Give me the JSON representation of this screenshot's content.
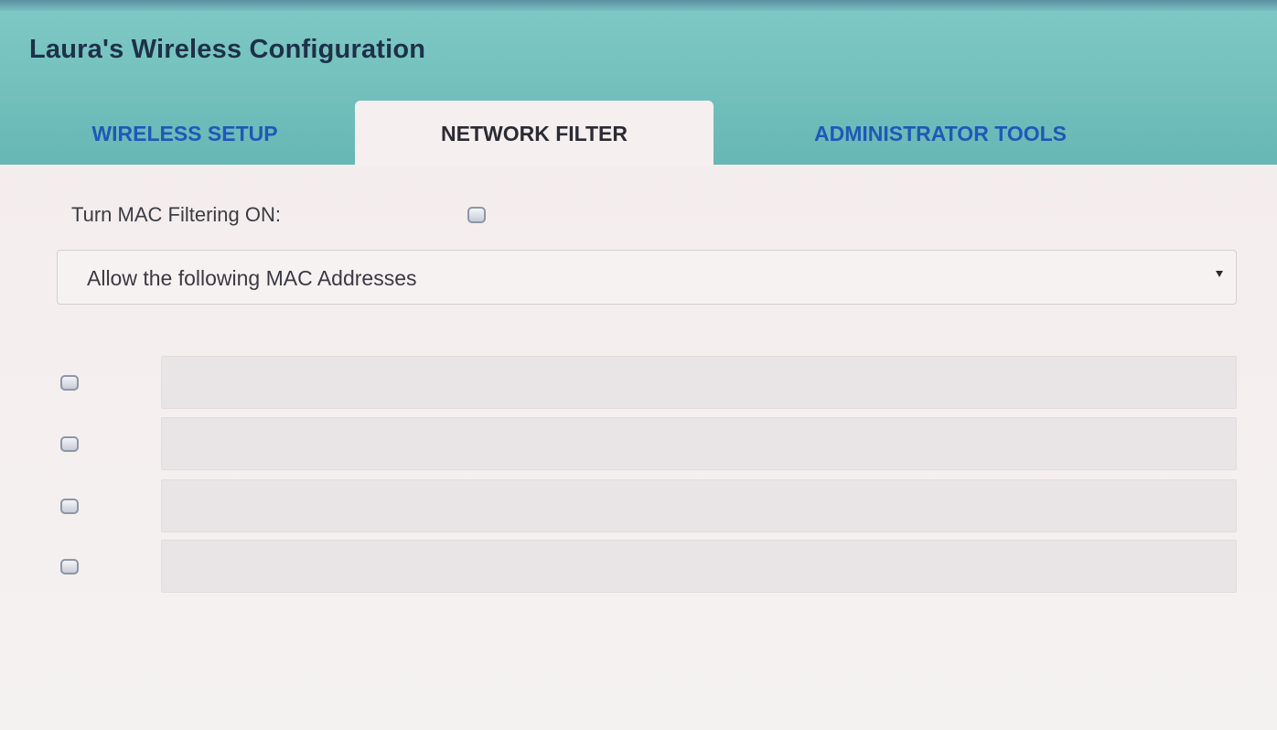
{
  "app": {
    "title": "Laura's Wireless Configuration"
  },
  "tabs": [
    {
      "label": "WIRELESS SETUP",
      "active": false
    },
    {
      "label": "NETWORK FILTER",
      "active": true
    },
    {
      "label": "ADMINISTRATOR TOOLS",
      "active": false
    }
  ],
  "network_filter": {
    "mac_filter_label": "Turn MAC Filtering ON:",
    "mac_filter_checked": false,
    "mode_select": {
      "selected": "Allow the following MAC Addresses"
    },
    "mac_entries": [
      {
        "checked": false,
        "value": ""
      },
      {
        "checked": false,
        "value": ""
      },
      {
        "checked": false,
        "value": ""
      },
      {
        "checked": false,
        "value": ""
      }
    ]
  },
  "colors": {
    "header": "#73c0bd",
    "title_text": "#1d3148",
    "inactive_tab_text": "#1e59b7",
    "active_tab_bg": "#f5efef",
    "content_bg": "#f4eeee",
    "input_bg": "#e9e4e5"
  }
}
